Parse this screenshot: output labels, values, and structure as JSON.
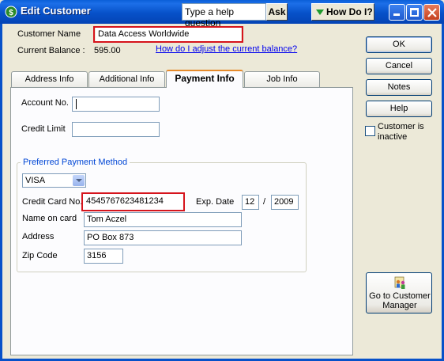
{
  "window": {
    "title": "Edit Customer",
    "help_box_text": "Type a help question",
    "ask_label": "Ask",
    "how_do_i_label": "How Do I?"
  },
  "header": {
    "customer_name_label": "Customer Name",
    "customer_name_value": "Data Access Worldwide",
    "current_balance_label": "Current Balance :",
    "current_balance_value": "595.00",
    "adjust_balance_link": "How do I adjust the current balance?"
  },
  "tabs": [
    {
      "label": "Address Info"
    },
    {
      "label": "Additional Info"
    },
    {
      "label": "Payment Info"
    },
    {
      "label": "Job Info"
    }
  ],
  "payment": {
    "account_no_label": "Account No.",
    "account_no_value": "",
    "credit_limit_label": "Credit Limit",
    "credit_limit_value": "",
    "group_title": "Preferred Payment Method",
    "method_value": "VISA",
    "cc_no_label": "Credit Card No.",
    "cc_no_value": "4545767623481234",
    "exp_date_label": "Exp. Date",
    "exp_month": "12",
    "exp_sep": "/",
    "exp_year": "2009",
    "name_on_card_label": "Name on card",
    "name_on_card_value": "Tom Aczel",
    "address_label": "Address",
    "address_value": "PO Box 873",
    "zip_label": "Zip Code",
    "zip_value": "3156"
  },
  "buttons": {
    "ok": "OK",
    "cancel": "Cancel",
    "notes": "Notes",
    "help": "Help",
    "inactive_label_1": "Customer is",
    "inactive_label_2": "inactive",
    "goto_1": "Go to Customer",
    "goto_2": "Manager"
  },
  "colors": {
    "titlebar": "#0751c9",
    "highlight_box": "#d6141c",
    "group_title": "#0046d5",
    "link": "#0000ee"
  }
}
